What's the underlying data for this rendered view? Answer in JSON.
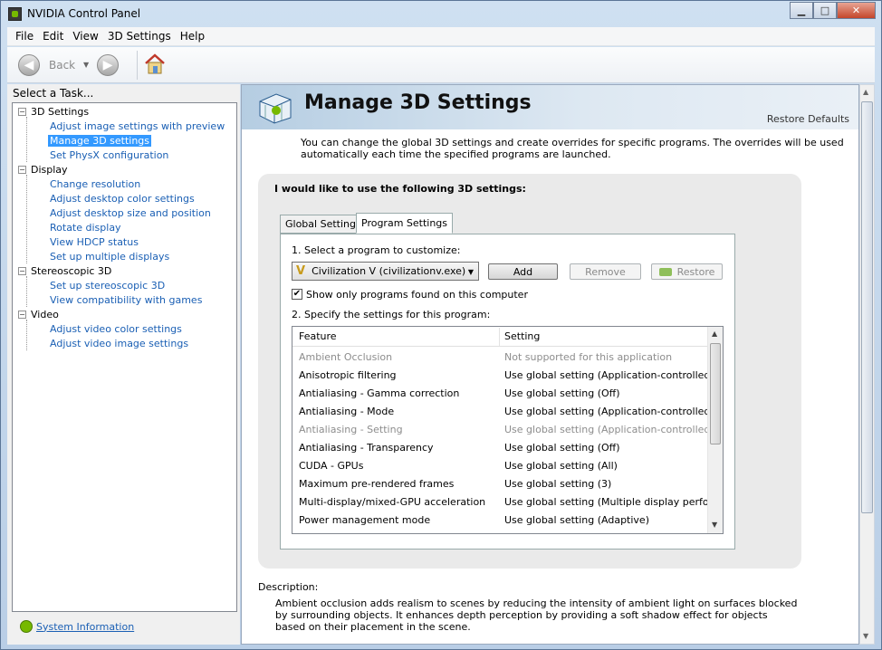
{
  "window": {
    "title": "NVIDIA Control Panel",
    "minimize": "▁",
    "maximize": "□",
    "close": "✕"
  },
  "menu": [
    "File",
    "Edit",
    "View",
    "3D Settings",
    "Help"
  ],
  "toolbar": {
    "back_label": "Back",
    "back_icon": "◀",
    "forward_icon": "▶",
    "dropdown_icon": "▼"
  },
  "sidebar": {
    "heading": "Select a Task...",
    "categories": [
      {
        "label": "3D Settings",
        "children": [
          "Adjust image settings with preview",
          "Manage 3D settings",
          "Set PhysX configuration"
        ]
      },
      {
        "label": "Display",
        "children": [
          "Change resolution",
          "Adjust desktop color settings",
          "Adjust desktop size and position",
          "Rotate display",
          "View HDCP status",
          "Set up multiple displays"
        ]
      },
      {
        "label": "Stereoscopic 3D",
        "children": [
          "Set up stereoscopic 3D",
          "View compatibility with games"
        ]
      },
      {
        "label": "Video",
        "children": [
          "Adjust video color settings",
          "Adjust video image settings"
        ]
      }
    ],
    "selected": "Manage 3D settings",
    "system_info": "System Information"
  },
  "main": {
    "title": "Manage 3D Settings",
    "restore_defaults": "Restore Defaults",
    "intro": "You can change the global 3D settings and create overrides for specific programs. The overrides will be used automatically each time the specified programs are launched.",
    "panel_heading": "I would like to use the following 3D settings:",
    "tabs": [
      "Global Settings",
      "Program Settings"
    ],
    "active_tab": "Program Settings",
    "step1": "1. Select a program to customize:",
    "program_value": "Civilization V (civilizationv.exe)",
    "buttons": {
      "add": "Add",
      "remove": "Remove",
      "restore": "Restore"
    },
    "checkbox_label": "Show only programs found on this computer",
    "checkbox_checked": true,
    "step2": "2. Specify the settings for this program:",
    "columns": [
      "Feature",
      "Setting"
    ],
    "rows": [
      {
        "feature": "Ambient Occlusion",
        "setting": "Not supported for this application",
        "dim": true
      },
      {
        "feature": "Anisotropic filtering",
        "setting": "Use global setting (Application-controlled)",
        "dim": false
      },
      {
        "feature": "Antialiasing - Gamma correction",
        "setting": "Use global setting (Off)",
        "dim": false
      },
      {
        "feature": "Antialiasing - Mode",
        "setting": "Use global setting (Application-controlled)",
        "dim": false
      },
      {
        "feature": "Antialiasing - Setting",
        "setting": "Use global setting (Application-controlled)",
        "dim": true
      },
      {
        "feature": "Antialiasing - Transparency",
        "setting": "Use global setting (Off)",
        "dim": false
      },
      {
        "feature": "CUDA - GPUs",
        "setting": "Use global setting (All)",
        "dim": false
      },
      {
        "feature": "Maximum pre-rendered frames",
        "setting": "Use global setting (3)",
        "dim": false
      },
      {
        "feature": "Multi-display/mixed-GPU acceleration",
        "setting": "Use global setting (Multiple display perfor...",
        "dim": false
      },
      {
        "feature": "Power management mode",
        "setting": "Use global setting (Adaptive)",
        "dim": false
      }
    ],
    "description_label": "Description:",
    "description": "Ambient occlusion adds realism to scenes by reducing the intensity of ambient light on surfaces blocked by surrounding objects. It enhances depth perception by providing a soft shadow effect for objects based on their placement in the scene."
  },
  "colors": {
    "accent": "#3399ff",
    "link": "#1a5fb4",
    "nvidia_green": "#76b900"
  }
}
